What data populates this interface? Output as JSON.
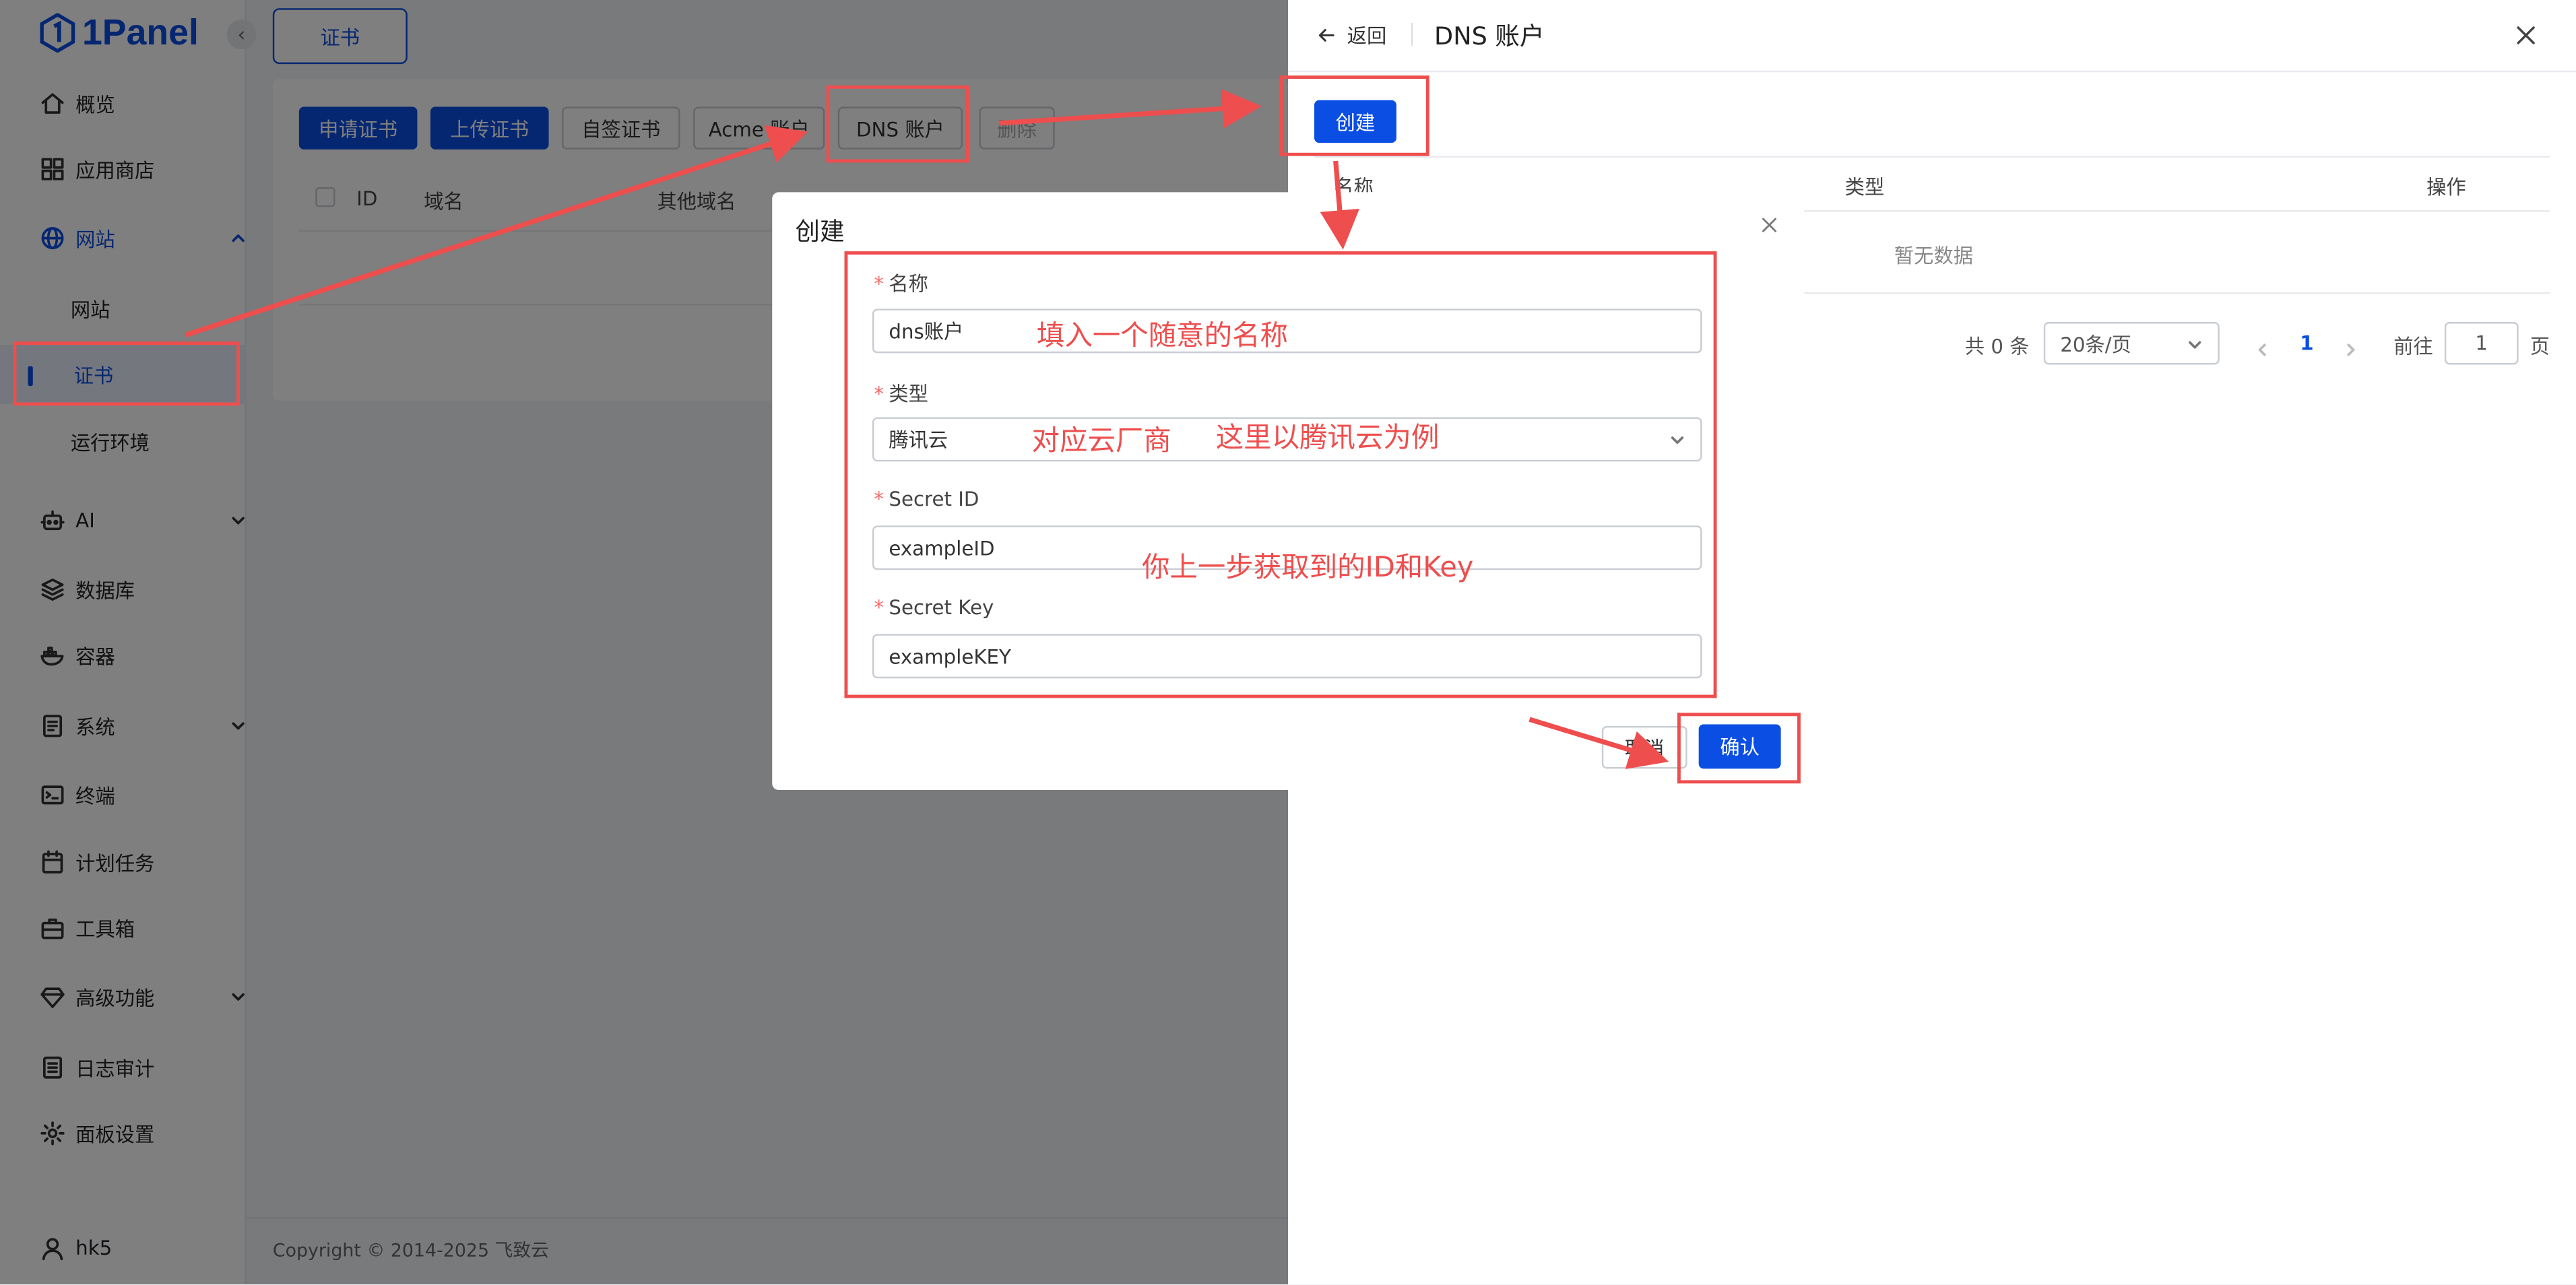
{
  "app": {
    "logo_text": "1Panel",
    "user_name": "hk5",
    "copyright": "Copyright © 2014-2025 飞致云"
  },
  "sidebar": {
    "items": [
      {
        "label": "概览",
        "icon": "home-icon"
      },
      {
        "label": "应用商店",
        "icon": "grid-icon"
      },
      {
        "label": "网站",
        "icon": "globe-icon",
        "expanded": true
      },
      {
        "label": "AI",
        "icon": "robot-icon"
      },
      {
        "label": "数据库",
        "icon": "layers-icon"
      },
      {
        "label": "容器",
        "icon": "docker-icon"
      },
      {
        "label": "系统",
        "icon": "system-icon"
      },
      {
        "label": "终端",
        "icon": "terminal-icon"
      },
      {
        "label": "计划任务",
        "icon": "calendar-icon"
      },
      {
        "label": "工具箱",
        "icon": "toolbox-icon"
      },
      {
        "label": "高级功能",
        "icon": "diamond-icon"
      },
      {
        "label": "日志审计",
        "icon": "log-icon"
      },
      {
        "label": "面板设置",
        "icon": "settings-icon"
      }
    ],
    "website_sub": [
      {
        "label": "网站",
        "active": false
      },
      {
        "label": "证书",
        "active": true
      },
      {
        "label": "运行环境",
        "active": false
      }
    ]
  },
  "main": {
    "tab": "证书",
    "toolbar": {
      "apply": "申请证书",
      "upload": "上传证书",
      "selfsign": "自签证书",
      "acme": "Acme 账户",
      "dns": "DNS 账户",
      "delete": "删除"
    },
    "table_headers": [
      "ID",
      "域名",
      "其他域名"
    ]
  },
  "drawer": {
    "back_label": "返回",
    "title": "DNS 账户",
    "create_label": "创建",
    "columns": [
      "名称",
      "类型",
      "操作"
    ],
    "empty_text": "暂无数据",
    "pagination": {
      "total": "共 0 条",
      "page_size": "20条/页",
      "current_page": "1",
      "goto_label": "前往",
      "goto_value": "1",
      "page_suffix": "页"
    }
  },
  "dialog": {
    "title": "创建",
    "fields": [
      {
        "label": "名称",
        "value": "dns账户"
      },
      {
        "label": "类型",
        "value": "腾讯云"
      },
      {
        "label": "Secret ID",
        "value": "exampleID"
      },
      {
        "label": "Secret Key",
        "value": "exampleKEY"
      }
    ],
    "cancel_label": "取消",
    "confirm_label": "确认"
  },
  "annotations": {
    "name_hint": "填入一个随意的名称",
    "type_hint_1": "对应云厂商",
    "type_hint_2": "这里以腾讯云为例",
    "key_hint": "你上一步获取到的ID和Key"
  },
  "colors": {
    "accent": "#0b4ee4",
    "annotation": "#ee4e4e",
    "overlay": "rgba(0,0,0,0.5)"
  }
}
